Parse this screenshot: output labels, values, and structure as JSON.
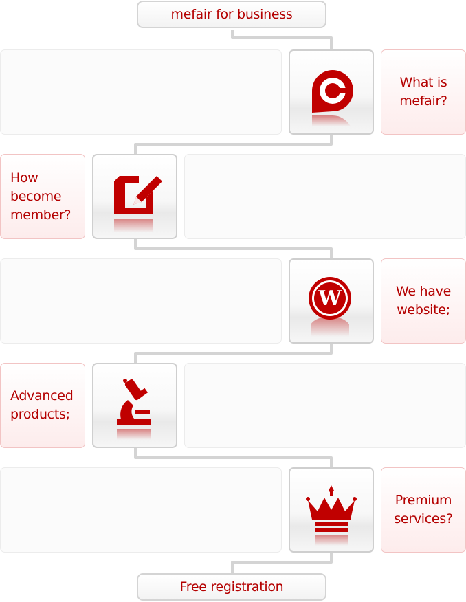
{
  "colors": {
    "accent": "#b40000",
    "icon": "#c00000",
    "connector": "#d4d4d4"
  },
  "start": {
    "label": "mefair for business"
  },
  "end": {
    "label": "Free registration"
  },
  "steps": [
    {
      "label": "What is\nmefair?",
      "icon": "target-pin-icon"
    },
    {
      "label": "How\nbecome\nmember?",
      "icon": "edit-document-icon"
    },
    {
      "label": "We have\nwebsite;",
      "icon": "wordpress-icon"
    },
    {
      "label": "Advanced\nproducts;",
      "icon": "microscope-icon"
    },
    {
      "label": "Premium\nservices?",
      "icon": "crown-icon"
    }
  ]
}
